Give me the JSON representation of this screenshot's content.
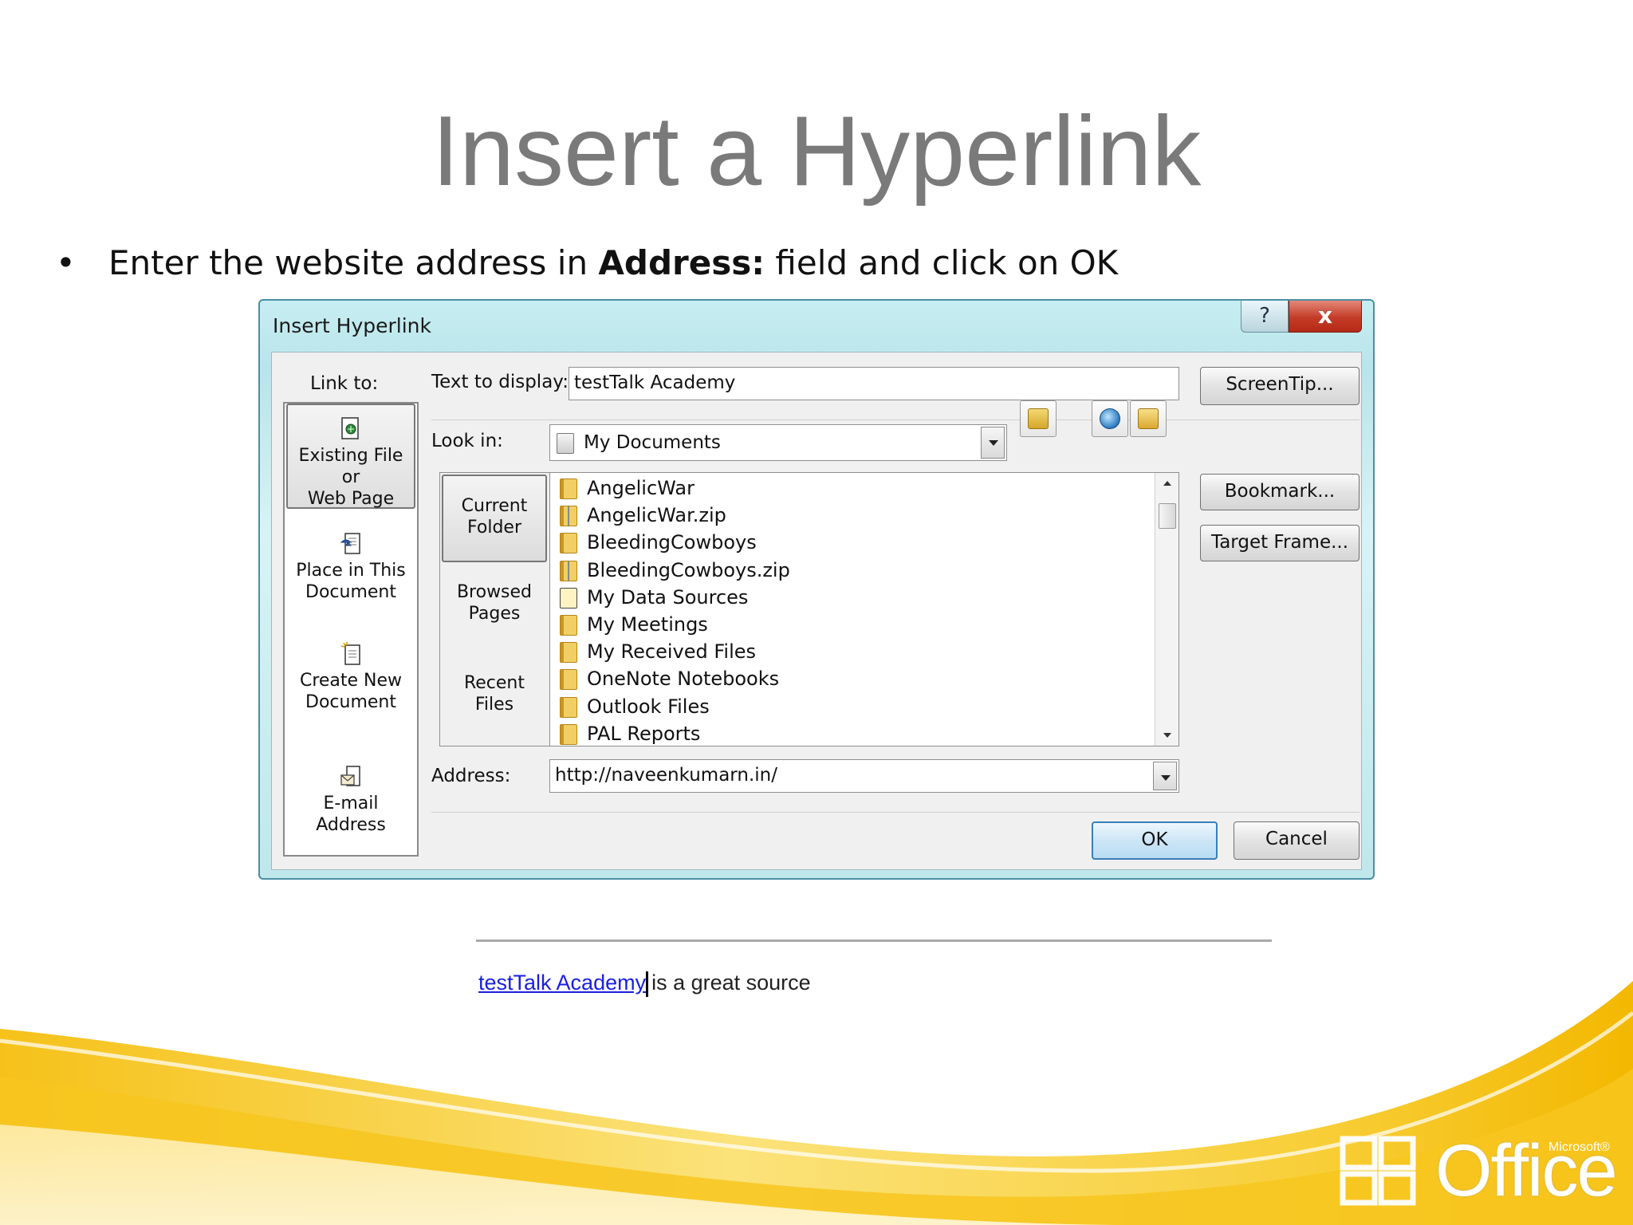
{
  "slide": {
    "title": "Insert a Hyperlink",
    "bullet_dot": "•",
    "bullet_pre": "Enter the website address in ",
    "bullet_bold": "Address:",
    "bullet_post": " field and click on OK"
  },
  "dialog": {
    "title": "Insert Hyperlink",
    "help_label": "?",
    "close_label": "x",
    "link_to_label": "Link to:",
    "link_to_items": [
      {
        "label_line1": "Existing File or",
        "label_line2": "Web Page",
        "icon": "existing-file-icon",
        "selected": true
      },
      {
        "label_line1": "Place in This",
        "label_line2": "Document",
        "icon": "place-in-document-icon",
        "selected": false
      },
      {
        "label_line1": "Create New",
        "label_line2": "Document",
        "icon": "create-new-document-icon",
        "selected": false
      },
      {
        "label_line1": "E-mail Address",
        "label_line2": "",
        "icon": "email-icon",
        "selected": false
      }
    ],
    "text_to_display_label": "Text to display:",
    "text_to_display_value": "testTalk Academy",
    "screentip_label": "ScreenTip...",
    "look_in_label": "Look in:",
    "look_in_value": "My Documents",
    "browse_nav": [
      {
        "line1": "Current",
        "line2": "Folder",
        "selected": true
      },
      {
        "line1": "Browsed",
        "line2": "Pages",
        "selected": false
      },
      {
        "line1": "Recent",
        "line2": "Files",
        "selected": false
      }
    ],
    "files": [
      {
        "name": "AngelicWar",
        "type": "folder"
      },
      {
        "name": "AngelicWar.zip",
        "type": "zip"
      },
      {
        "name": "BleedingCowboys",
        "type": "folder"
      },
      {
        "name": "BleedingCowboys.zip",
        "type": "zip"
      },
      {
        "name": "My Data Sources",
        "type": "datasource"
      },
      {
        "name": "My Meetings",
        "type": "folder"
      },
      {
        "name": "My Received Files",
        "type": "folder"
      },
      {
        "name": "OneNote Notebooks",
        "type": "folder"
      },
      {
        "name": "Outlook Files",
        "type": "folder"
      },
      {
        "name": "PAL Reports",
        "type": "folder"
      }
    ],
    "bookmark_label": "Bookmark...",
    "target_frame_label": "Target Frame...",
    "address_label": "Address:",
    "address_value": "http://naveenkumarn.in/",
    "ok_label": "OK",
    "cancel_label": "Cancel"
  },
  "sample": {
    "link_text": "testTalk Academy",
    "rest_text": "is a great source"
  },
  "branding": {
    "logo_text": "Office",
    "logo_super": "Microsoft®"
  },
  "colors": {
    "title_gray": "#7a7a7a",
    "link_blue": "#1a20e0",
    "swoosh_yellow": "#f5c400"
  }
}
